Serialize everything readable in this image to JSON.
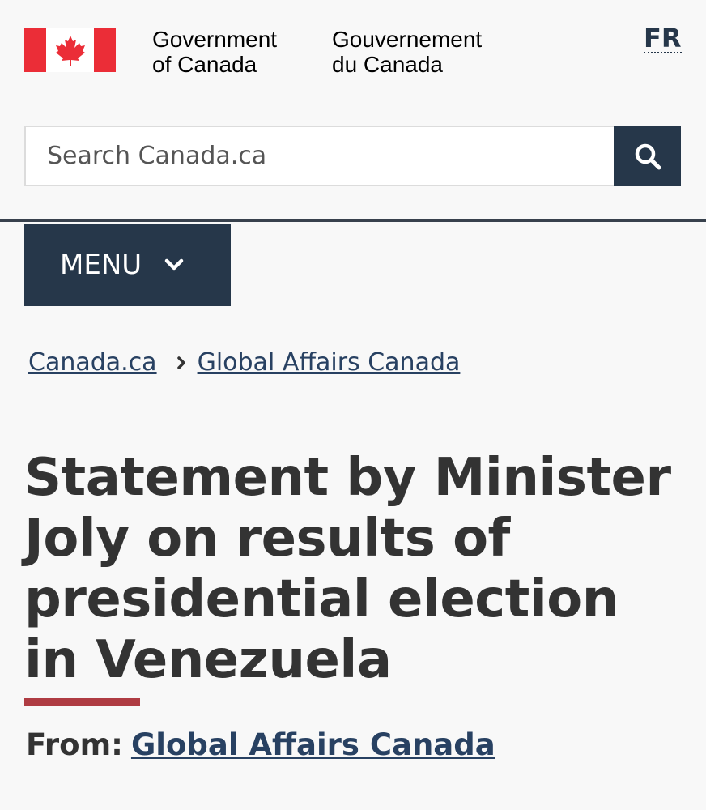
{
  "header": {
    "signature_en_line1": "Government",
    "signature_en_line2": "of Canada",
    "signature_fr_line1": "Gouvernement",
    "signature_fr_line2": "du Canada",
    "language_toggle": "FR",
    "flag_icon": "canada-flag-icon"
  },
  "search": {
    "placeholder": "Search Canada.ca",
    "button_icon": "search-icon"
  },
  "menu": {
    "label": "MENU",
    "icon": "chevron-down-icon"
  },
  "breadcrumb": {
    "items": [
      "Canada.ca",
      "Global Affairs Canada"
    ],
    "separator_icon": "chevron-right-icon"
  },
  "page": {
    "title": "Statement by Minister Joly on results of presidential election in Venezuela",
    "from_label": "From:",
    "from_link": "Global Affairs Canada"
  },
  "colors": {
    "brand_dark": "#26374a",
    "flag_red": "#eb2d37",
    "title_rule": "#af3c43",
    "link": "#284162"
  }
}
